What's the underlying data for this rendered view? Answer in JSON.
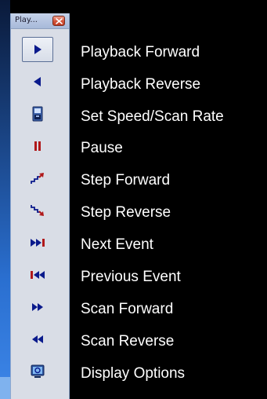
{
  "window": {
    "title": "Play...",
    "close_icon": "close-icon"
  },
  "colors": {
    "background": "#000000",
    "icon_blue": "#0a1a8c",
    "icon_red": "#b0181a",
    "label_text": "#ffffff"
  },
  "items": [
    {
      "label": "Playback Forward",
      "icon": "play-forward-icon",
      "active": true
    },
    {
      "label": "Playback Reverse",
      "icon": "play-reverse-icon"
    },
    {
      "label": "Set Speed/Scan Rate",
      "icon": "speed-rate-icon"
    },
    {
      "label": "Pause",
      "icon": "pause-icon"
    },
    {
      "label": "Step Forward",
      "icon": "step-forward-icon"
    },
    {
      "label": "Step Reverse",
      "icon": "step-reverse-icon"
    },
    {
      "label": "Next Event",
      "icon": "next-event-icon"
    },
    {
      "label": "Previous Event",
      "icon": "previous-event-icon"
    },
    {
      "label": "Scan Forward",
      "icon": "scan-forward-icon"
    },
    {
      "label": "Scan Reverse",
      "icon": "scan-reverse-icon"
    },
    {
      "label": "Display Options",
      "icon": "display-options-icon"
    }
  ]
}
